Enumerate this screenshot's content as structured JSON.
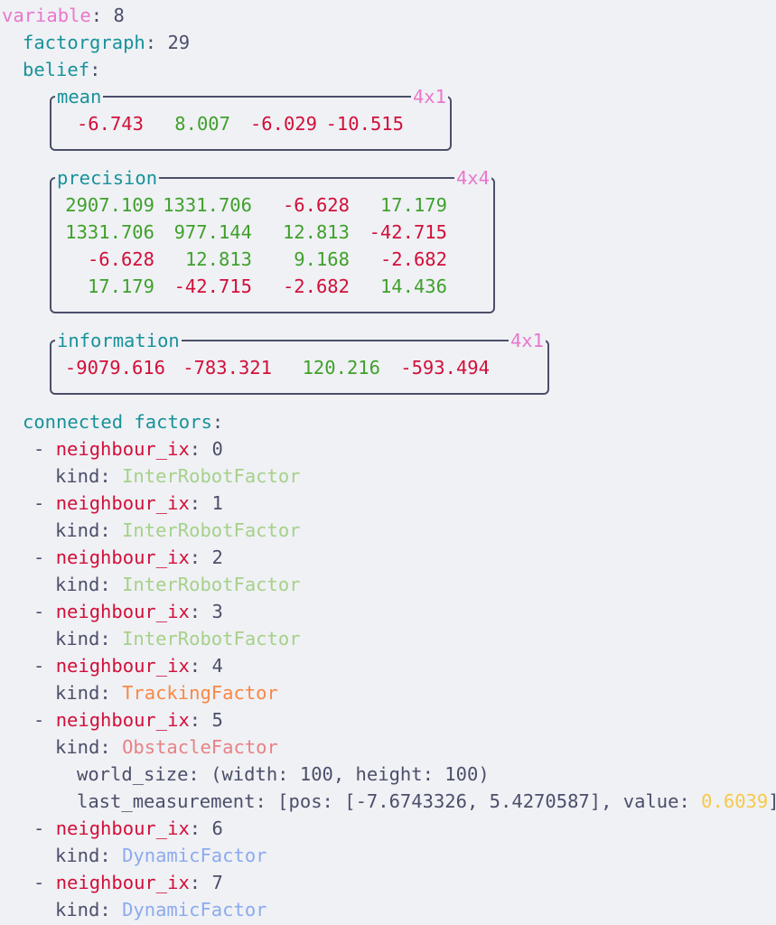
{
  "variable": {
    "label": "variable",
    "value": "8"
  },
  "factorgraph": {
    "label": "factorgraph",
    "value": "29"
  },
  "belief": {
    "label": "belief"
  },
  "mean": {
    "title": "mean",
    "dim": "4x1",
    "values": [
      "-6.743",
      "8.007",
      "-6.029",
      "-10.515"
    ]
  },
  "precision": {
    "title": "precision",
    "dim": "4x4",
    "rows": [
      [
        "2907.109",
        "1331.706",
        "-6.628",
        "17.179"
      ],
      [
        "1331.706",
        "977.144",
        "12.813",
        "-42.715"
      ],
      [
        "-6.628",
        "12.813",
        "9.168",
        "-2.682"
      ],
      [
        "17.179",
        "-42.715",
        "-2.682",
        "14.436"
      ]
    ]
  },
  "information": {
    "title": "information",
    "dim": "4x1",
    "values": [
      "-9079.616",
      "-783.321",
      "120.216",
      "-593.494"
    ]
  },
  "connected": {
    "label": "connected factors"
  },
  "factors": [
    {
      "ix_label": "neighbour_ix",
      "ix": "0",
      "kind_label": "kind",
      "kind": "InterRobotFactor"
    },
    {
      "ix_label": "neighbour_ix",
      "ix": "1",
      "kind_label": "kind",
      "kind": "InterRobotFactor"
    },
    {
      "ix_label": "neighbour_ix",
      "ix": "2",
      "kind_label": "kind",
      "kind": "InterRobotFactor"
    },
    {
      "ix_label": "neighbour_ix",
      "ix": "3",
      "kind_label": "kind",
      "kind": "InterRobotFactor"
    },
    {
      "ix_label": "neighbour_ix",
      "ix": "4",
      "kind_label": "kind",
      "kind": "TrackingFactor"
    },
    {
      "ix_label": "neighbour_ix",
      "ix": "5",
      "kind_label": "kind",
      "kind": "ObstacleFactor",
      "world_size_label": "world_size",
      "world_size": "(width: 100, height: 100)",
      "last_measurement_label": "last_measurement",
      "last_measurement_prefix": "[pos: [-7.6743326, 5.4270587], value: ",
      "last_measurement_value": "0.6039",
      "last_measurement_suffix": "]"
    },
    {
      "ix_label": "neighbour_ix",
      "ix": "6",
      "kind_label": "kind",
      "kind": "DynamicFactor"
    },
    {
      "ix_label": "neighbour_ix",
      "ix": "7",
      "kind_label": "kind",
      "kind": "DynamicFactor"
    }
  ]
}
